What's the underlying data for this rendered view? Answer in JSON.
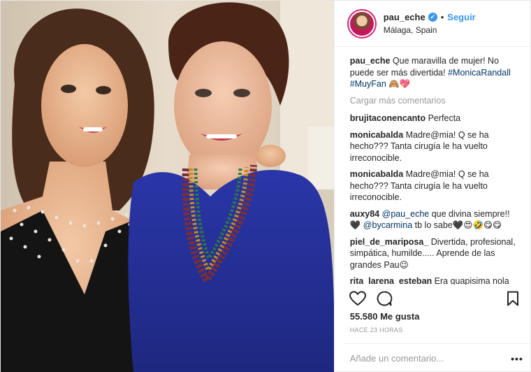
{
  "post": {
    "username": "pau_eche",
    "follow_label": "Seguir",
    "separator": "•",
    "location": "Málaga, Spain",
    "verified_icon": "✔",
    "caption": {
      "user": "pau_eche",
      "text": "Que maravilla de mujer! No puede ser más divertida!",
      "hashtags": [
        "#MonicaRandall",
        "#MuyFan"
      ],
      "emoji": "🙈💖"
    },
    "load_more_label": "Cargar más comentarios",
    "comments": [
      {
        "user": "brujitaconencanto",
        "text": "Perfecta"
      },
      {
        "user": "monicabalda",
        "text": "Madre@mia! Q se ha hecho??? Tanta cirugía le ha vuelto irreconocible."
      },
      {
        "user": "monicabalda",
        "text": "Madre@mia! Q se ha hecho??? Tanta cirugía le ha vuelto irreconocible."
      },
      {
        "user": "auxy84",
        "mention1": "@pau_eche",
        "text1": "que divina siempre!! 🖤",
        "mention2": "@bycarmina",
        "text2": "tb lo sabe🖤😍🤣😋😋"
      },
      {
        "user": "piel_de_mariposa_",
        "text": "Divertida, profesional, simpática, humilde..... Aprende de las grandes Pau😉"
      },
      {
        "user": "rita_larena_esteban",
        "text": "Era guapisima nola reconozco"
      }
    ],
    "likes": "55.580 Me gusta",
    "timestamp": "HACE 23 HORAS",
    "add_comment_placeholder": "Añade un comentario...",
    "more_label": "•••"
  },
  "colors": {
    "link_blue": "#3897f0",
    "hashtag": "#003569",
    "muted": "#999999",
    "text": "#262626"
  }
}
